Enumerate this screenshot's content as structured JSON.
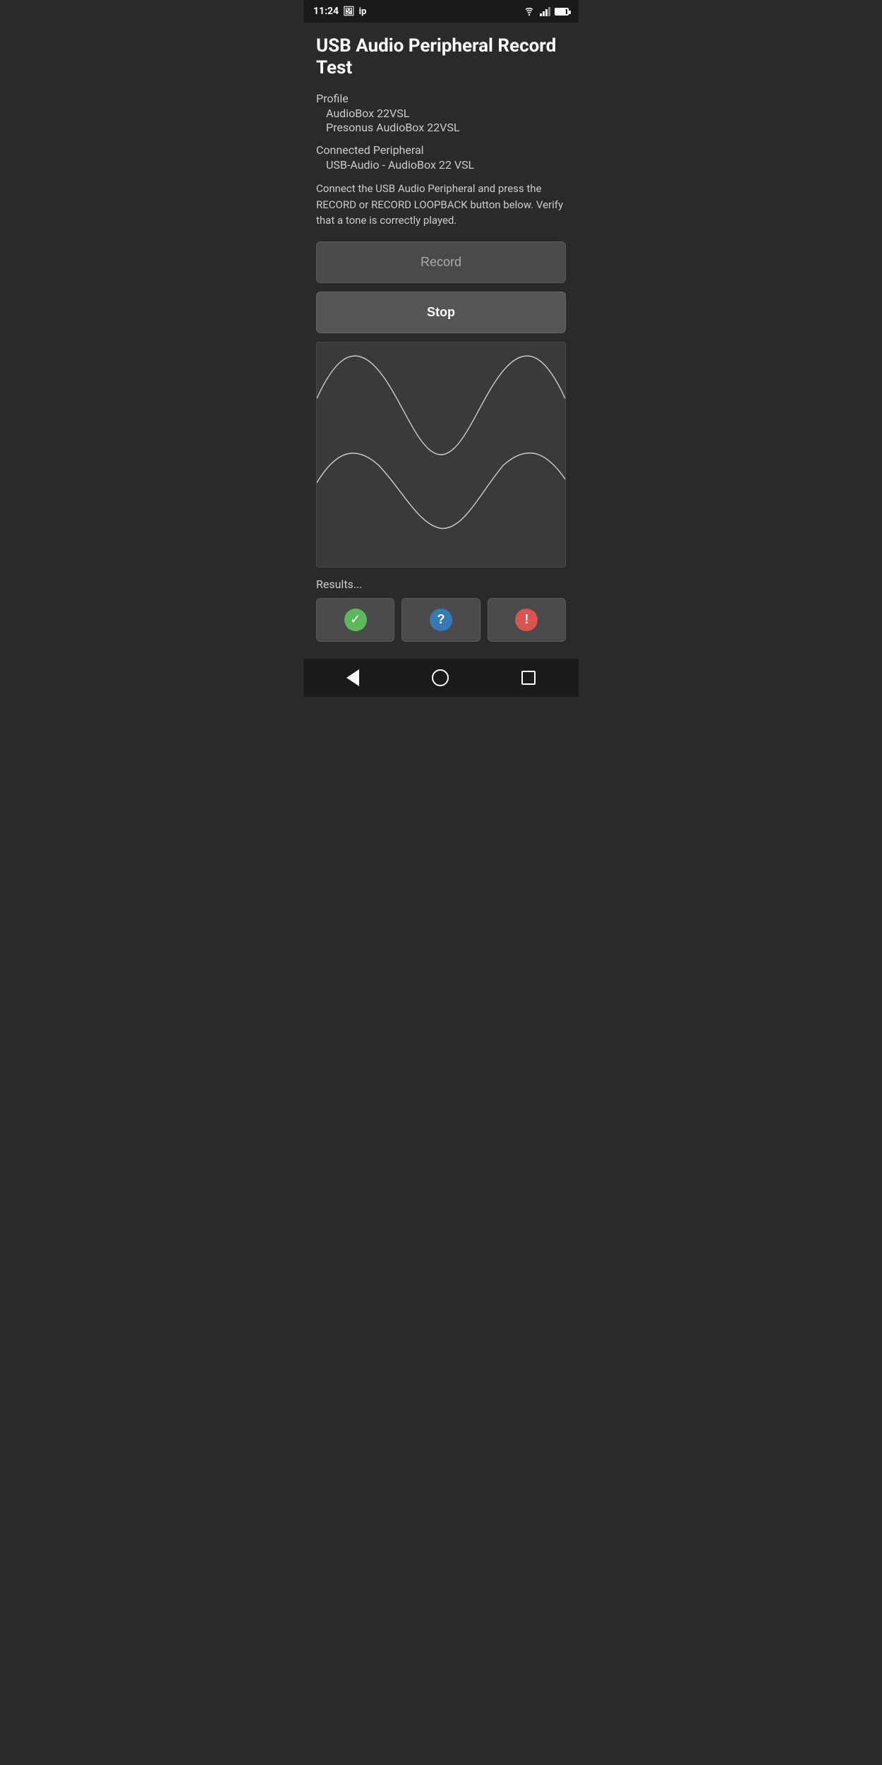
{
  "status_bar": {
    "time": "11:24",
    "icons": [
      "photo",
      "ip"
    ]
  },
  "header": {
    "title": "USB Audio Peripheral Record Test"
  },
  "profile": {
    "label": "Profile",
    "line1": "AudioBox 22VSL",
    "line2": "Presonus AudioBox 22VSL"
  },
  "connected_peripheral": {
    "label": "Connected Peripheral",
    "value": "USB-Audio - AudioBox 22 VSL"
  },
  "instruction": {
    "text": "Connect the USB Audio Peripheral and press the RECORD or RECORD LOOPBACK button below. Verify that a tone is correctly played."
  },
  "buttons": {
    "record_label": "Record",
    "stop_label": "Stop"
  },
  "results": {
    "label": "Results...",
    "check_icon": "✓",
    "question_icon": "?",
    "exclaim_icon": "!"
  },
  "nav": {
    "back_label": "back",
    "home_label": "home",
    "recent_label": "recent"
  }
}
